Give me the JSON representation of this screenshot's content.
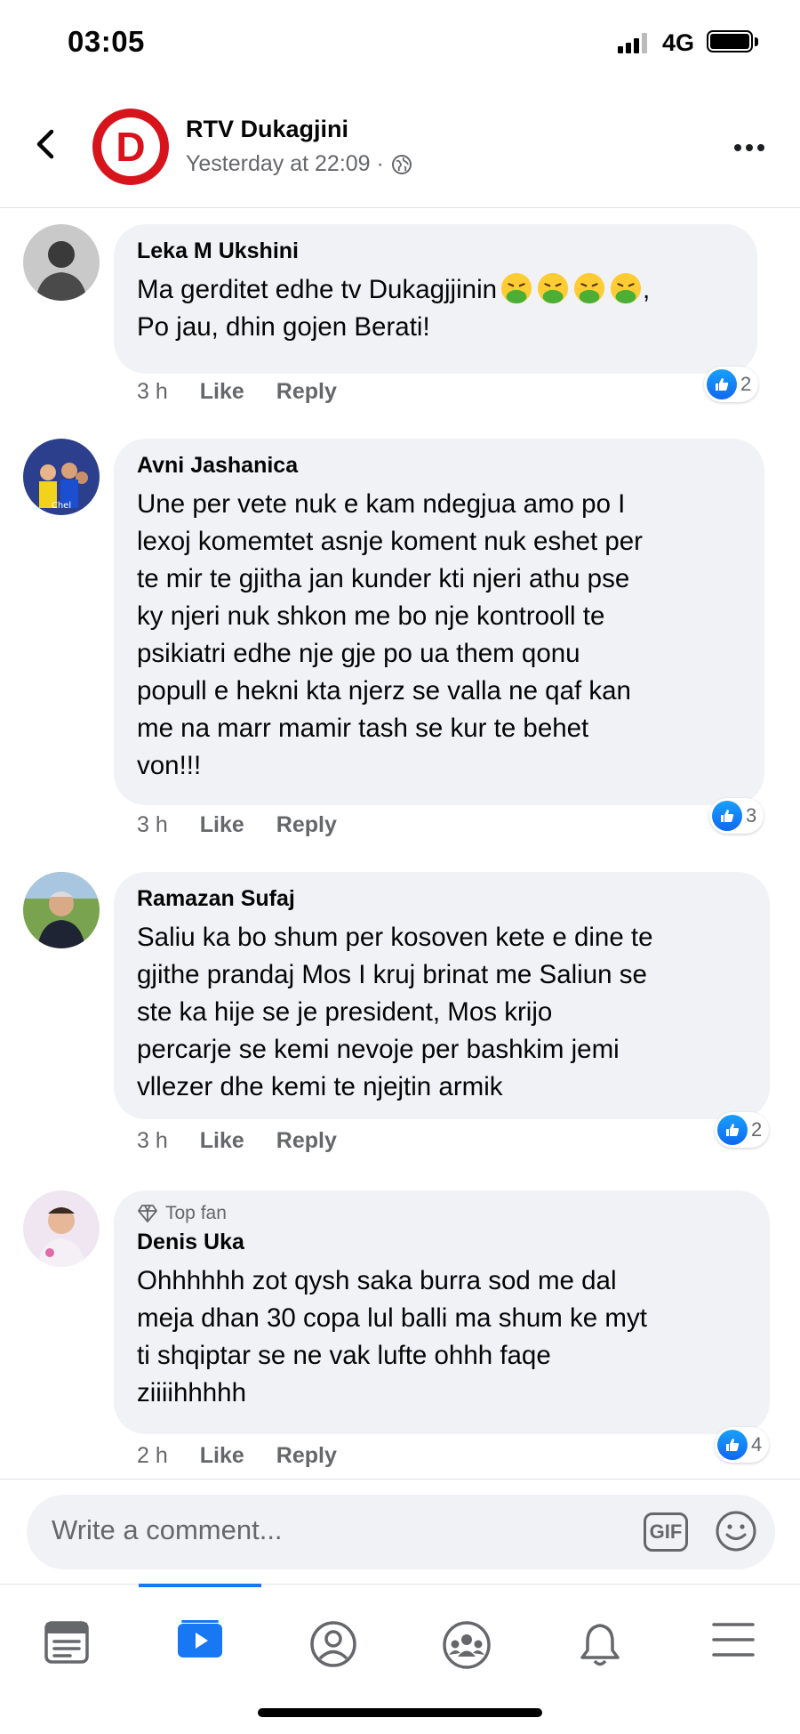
{
  "status_bar": {
    "time": "03:05",
    "network": "4G"
  },
  "header": {
    "page_name": "RTV Dukagjini",
    "post_time": "Yesterday at 22:09 ·",
    "logo_letter": "D"
  },
  "comments": [
    {
      "author": "Leka M Ukshini",
      "text_line1": "Ma gerditet edhe tv Dukagjjinin",
      "text_line2": ",\nPo jau, dhin gojen Berati!",
      "time": "3 h",
      "like_label": "Like",
      "reply_label": "Reply",
      "reaction_count": "2"
    },
    {
      "author": "Avni Jashanica",
      "text": "Une per vete nuk e kam ndegjua amo po I\nlexoj komemtet asnje koment nuk eshet per\nte mir te gjitha jan kunder kti njeri athu pse\nky njeri nuk shkon me bo nje kontrooll te\npsikiatri edhe nje gje po ua them qonu\npopull e hekni kta njerz se valla ne qaf kan\nme na marr mamir tash se kur te behet\nvon!!!",
      "time": "3 h",
      "like_label": "Like",
      "reply_label": "Reply",
      "reaction_count": "3"
    },
    {
      "author": "Ramazan Sufaj",
      "text": "Saliu ka bo shum per kosoven kete e dine te\ngjithe prandaj Mos I kruj brinat me Saliun se\nste ka hije se je president, Mos krijo\npercarje se kemi nevoje per bashkim jemi\nvllezer dhe kemi te njejtin armik",
      "time": "3 h",
      "like_label": "Like",
      "reply_label": "Reply",
      "reaction_count": "2"
    },
    {
      "badge": "Top fan",
      "author": "Denis Uka",
      "text": "Ohhhhhh zot qysh saka burra sod me dal\nmeja dhan 30 copa lul balli ma shum ke myt\nti shqiptar se ne vak lufte ohhh faqe\nziiiihhhhh",
      "time": "2 h",
      "like_label": "Like",
      "reply_label": "Reply",
      "reaction_count": "4"
    }
  ],
  "composer": {
    "placeholder": "Write a comment...",
    "gif_label": "GIF"
  },
  "tabs": [
    {
      "icon": "news-feed-icon",
      "active": false
    },
    {
      "icon": "watch-video-icon",
      "active": true
    },
    {
      "icon": "profile-icon",
      "active": false
    },
    {
      "icon": "groups-icon",
      "active": false
    },
    {
      "icon": "notifications-bell-icon",
      "active": false
    },
    {
      "icon": "menu-icon",
      "active": false
    }
  ],
  "colors": {
    "accent": "#1877f2",
    "bubble": "#f0f2f5",
    "secondary_text": "#65676b",
    "logo_red": "#d7141c"
  }
}
